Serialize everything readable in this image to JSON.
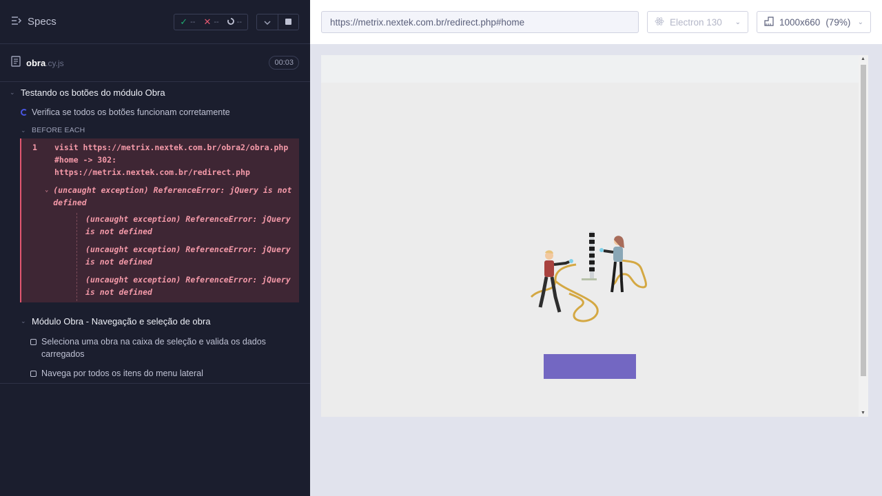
{
  "reporter": {
    "title": "Specs",
    "stats": {
      "passed": "--",
      "failed": "--",
      "pending": "--"
    },
    "file": {
      "name": "obra",
      "ext": ".cy.js",
      "duration": "00:03"
    },
    "suite1": {
      "title": "Testando os botões do módulo Obra"
    },
    "running_test": "Verifica se todos os botões funcionam corretamente",
    "hook_label": "BEFORE EACH",
    "command": {
      "number": "1",
      "text": "visit  https://metrix.nextek.com.br/obra2/obra.php #home -> 302: https://metrix.nextek.com.br/redirect.php"
    },
    "exception_head": "(uncaught exception)  ReferenceError: jQuery is not defined",
    "exceptions": [
      "(uncaught exception)  ReferenceError: jQuery is not defined",
      "(uncaught exception)  ReferenceError: jQuery is not defined",
      "(uncaught exception)  ReferenceError: jQuery is not defined"
    ],
    "suite2": {
      "title": "Módulo Obra - Navegação e seleção de obra"
    },
    "pending_tests": [
      "Seleciona uma obra na caixa de seleção e valida os dados carregados",
      "Navega por todos os itens do menu lateral"
    ]
  },
  "aut": {
    "url": "https://metrix.nextek.com.br/redirect.php#home",
    "browser": "Electron 130",
    "viewport": "1000x660",
    "zoom": "(79%)"
  },
  "colors": {
    "reporter_bg": "#1b1e2e",
    "error": "#e45770",
    "accent_purple": "#7367c2",
    "passed": "#1fa971"
  }
}
